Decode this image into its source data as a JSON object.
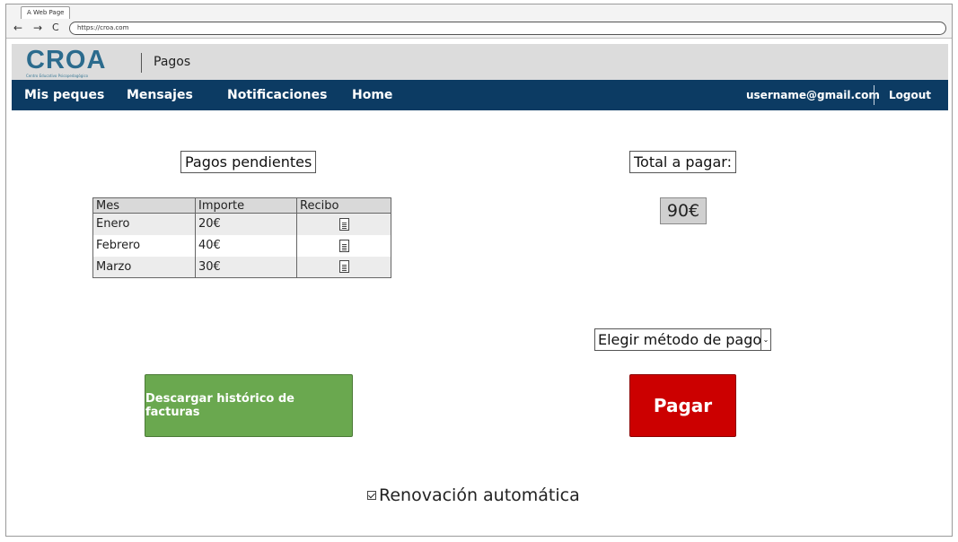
{
  "browser": {
    "tab_title": "A Web Page",
    "back_icon": "←",
    "forward_icon": "→",
    "reload_icon": "C",
    "url": "https://croa.com"
  },
  "header": {
    "logo_text": "CROA",
    "logo_subtext": "Centro Educativo Psicopedagógico",
    "page_title": "Pagos"
  },
  "nav": {
    "items": [
      "Mis peques",
      "Mensajes",
      "Notificaciones",
      "Home"
    ],
    "user_email": "username@gmail.com",
    "logout_label": "Logout",
    "bar_color": "#0c3b63"
  },
  "pending": {
    "title": "Pagos pendientes",
    "columns": [
      "Mes",
      "Importe",
      "Recibo"
    ],
    "rows": [
      {
        "month": "Enero",
        "amount": "20€",
        "receipt_icon": "document-icon"
      },
      {
        "month": "Febrero",
        "amount": "40€",
        "receipt_icon": "document-icon"
      },
      {
        "month": "Marzo",
        "amount": "30€",
        "receipt_icon": "document-icon"
      }
    ]
  },
  "total": {
    "label": "Total a pagar:",
    "amount": "90€"
  },
  "payment_method": {
    "selected": "Elegir método de pago"
  },
  "actions": {
    "history_button": "Descargar histórico de facturas",
    "history_color": "#6aa84f",
    "pay_button": "Pagar",
    "pay_color": "#cc0000"
  },
  "renewal": {
    "label": "Renovación automática",
    "checked": true
  }
}
